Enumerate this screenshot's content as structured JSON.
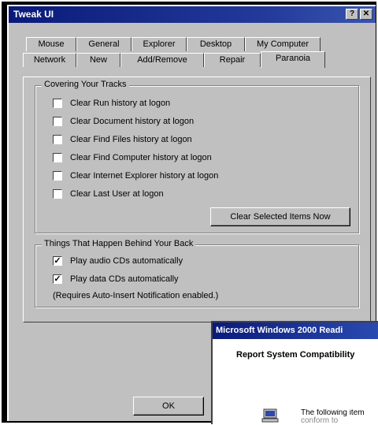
{
  "window": {
    "title": "Tweak UI",
    "help_button": "?",
    "close_button": "✕"
  },
  "tabs_back": [
    "Mouse",
    "General",
    "Explorer",
    "Desktop",
    "My Computer"
  ],
  "tabs_front": [
    "Network",
    "New",
    "Add/Remove",
    "Repair",
    "Paranoia"
  ],
  "group1": {
    "legend": "Covering Your Tracks",
    "items": [
      {
        "label": "Clear Run history at logon",
        "checked": false
      },
      {
        "label": "Clear Document history at logon",
        "checked": false
      },
      {
        "label": "Clear Find Files history at logon",
        "checked": false
      },
      {
        "label": "Clear Find Computer history at logon",
        "checked": false
      },
      {
        "label": "Clear Internet Explorer history at logon",
        "checked": false
      },
      {
        "label": "Clear Last User at logon",
        "checked": false
      }
    ],
    "button": "Clear Selected Items Now"
  },
  "group2": {
    "legend": "Things That Happen Behind Your Back",
    "items": [
      {
        "label": "Play audio CDs automatically",
        "checked": true
      },
      {
        "label": "Play data CDs automatically",
        "checked": true
      }
    ],
    "note": "(Requires Auto-Insert Notification enabled.)"
  },
  "ok_button": "OK",
  "overlay": {
    "title": "Microsoft Windows 2000 Readi",
    "heading": "Report System Compatibility",
    "body_line1": "The following item",
    "body_line2": "conform to"
  }
}
